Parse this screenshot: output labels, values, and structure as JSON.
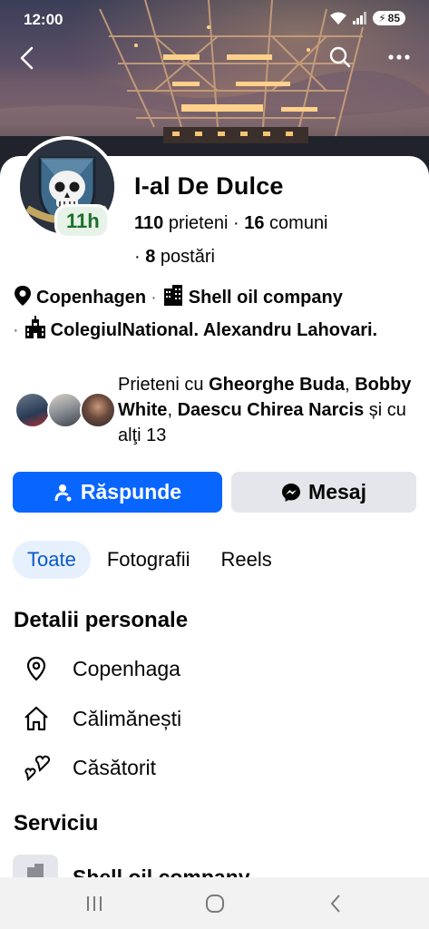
{
  "status": {
    "time": "12:00",
    "battery": "85"
  },
  "profile": {
    "name": "I-al De Dulce",
    "story_badge": "11h",
    "friends_count": "110",
    "friends_label": "prieteni",
    "communities_count": "16",
    "communities_label": "comuni",
    "posts_count": "8",
    "posts_label": "postări"
  },
  "info": {
    "location": "Copenhagen",
    "work": "Shell oil company",
    "school": "ColegiulNational. Alexandru Lahovari."
  },
  "mutual": {
    "prefix": "Prieteni cu",
    "friend1": "Gheorghe Buda",
    "comma": ",",
    "friend2": "Bobby White",
    "comma2": ",",
    "friend3": "Daescu Chirea Narcis",
    "suffix": "și cu alţi 13"
  },
  "actions": {
    "respond": "Răspunde",
    "message": "Mesaj"
  },
  "tabs": [
    {
      "label": "Toate",
      "active": true
    },
    {
      "label": "Fotografii"
    },
    {
      "label": "Reels"
    }
  ],
  "details": {
    "title": "Detalii personale",
    "items": [
      {
        "label": "Copenhaga",
        "icon": "location-pin-icon"
      },
      {
        "label": "Călimănești",
        "icon": "home-icon"
      },
      {
        "label": "Căsătorit",
        "icon": "hearts-icon"
      }
    ]
  },
  "service": {
    "title": "Serviciu",
    "item": "Shell oil company"
  },
  "colors": {
    "primary": "#0866ff",
    "secondary_bg": "#e4e6eb",
    "story_badge_text": "#1d6f2a",
    "active_tab_bg": "#e7f0fd"
  }
}
